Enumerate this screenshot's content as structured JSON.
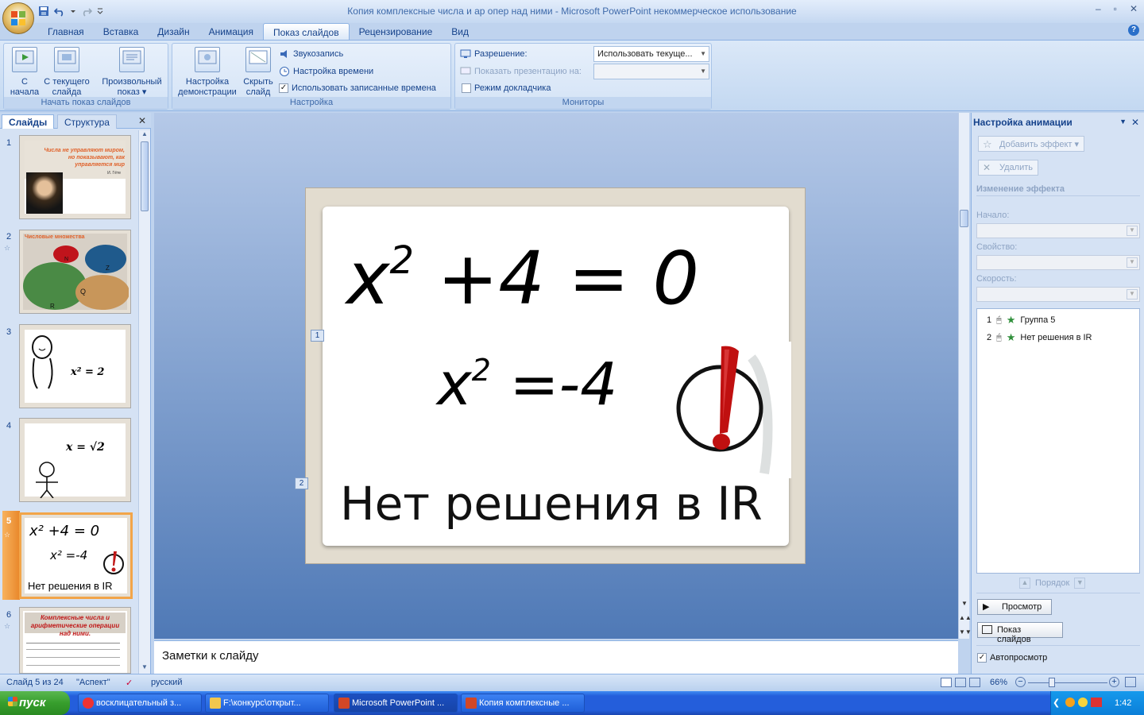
{
  "window": {
    "title": "Копия комплексные числа и ар опер над ними - Microsoft PowerPoint некоммерческое использование"
  },
  "tabs": [
    "Главная",
    "Вставка",
    "Дизайн",
    "Анимация",
    "Показ слайдов",
    "Рецензирование",
    "Вид"
  ],
  "active_tab": "Показ слайдов",
  "ribbon": {
    "group1": {
      "label": "Начать показ слайдов",
      "btn1": "С\nначала",
      "btn2": "С текущего\nслайда",
      "btn3": "Произвольный\nпоказ ▾"
    },
    "group2": {
      "label": "Настройка",
      "btn1": "Настройка\nдемонстрации",
      "btn2": "Скрыть\nслайд",
      "sound": "Звукозапись",
      "timing": "Настройка времени",
      "use_timings": "Использовать записанные времена",
      "use_timings_checked": true
    },
    "group3": {
      "label": "Мониторы",
      "resolution_label": "Разрешение:",
      "resolution_value": "Использовать текуще...",
      "show_on_label": "Показать презентацию на:",
      "presenter_view": "Режим докладчика",
      "presenter_checked": false
    }
  },
  "leftpane": {
    "tab_slides": "Слайды",
    "tab_outline": "Структура",
    "slides": [
      {
        "num": "1",
        "text": "Числа не управляют миром, но показывают, как управляется мир",
        "sig": "И. Гёте"
      },
      {
        "num": "2",
        "title": "Числовые множества",
        "labels": [
          "N",
          "Z",
          "Q",
          "R"
        ]
      },
      {
        "num": "3",
        "text": "x² = 2"
      },
      {
        "num": "4",
        "text": "x = √2"
      },
      {
        "num": "5",
        "line1": "x² +4 = 0",
        "line2": "x² =-4",
        "line3": "Нет решения в IR"
      },
      {
        "num": "6",
        "title": "Комплексные числа и арифметические операции над ними."
      }
    ]
  },
  "slide": {
    "eq1_base": "x",
    "eq1_exp": "2",
    "eq1_rest": " +4  =  0",
    "eq2_base": "x",
    "eq2_exp": "2",
    "eq2_rest": " =-4",
    "text": "Нет решения в IR",
    "tag1": "1",
    "tag2": "2"
  },
  "notes": {
    "placeholder": "Заметки к слайду"
  },
  "rightpane": {
    "title": "Настройка анимации",
    "add_effect": "Добавить эффект ▾",
    "delete": "Удалить",
    "change_effect": "Изменение эффекта",
    "start_label": "Начало:",
    "property_label": "Свойство:",
    "speed_label": "Скорость:",
    "items": [
      {
        "num": "1",
        "name": "Группа 5"
      },
      {
        "num": "2",
        "name": "Нет решения в IR"
      }
    ],
    "order_label": "Порядок",
    "preview": "Просмотр",
    "slideshow": "Показ слайдов",
    "autopreview": "Автопросмотр",
    "autopreview_checked": true
  },
  "status": {
    "slide": "Слайд 5 из 24",
    "theme": "\"Аспект\"",
    "lang": "русский",
    "zoom": "66%"
  },
  "taskbar": {
    "start": "пуск",
    "tasks": [
      "восклицательный з...",
      "F:\\конкурс\\открыт...",
      "Microsoft PowerPoint ...",
      "Копия комплексные ..."
    ],
    "clock": "1:42"
  },
  "colors": {
    "accent": "#f2a549",
    "ribbon": "#dbe8f8",
    "title": "#3e6aaa",
    "taskbar": "#245edb",
    "start": "#379e2d"
  }
}
